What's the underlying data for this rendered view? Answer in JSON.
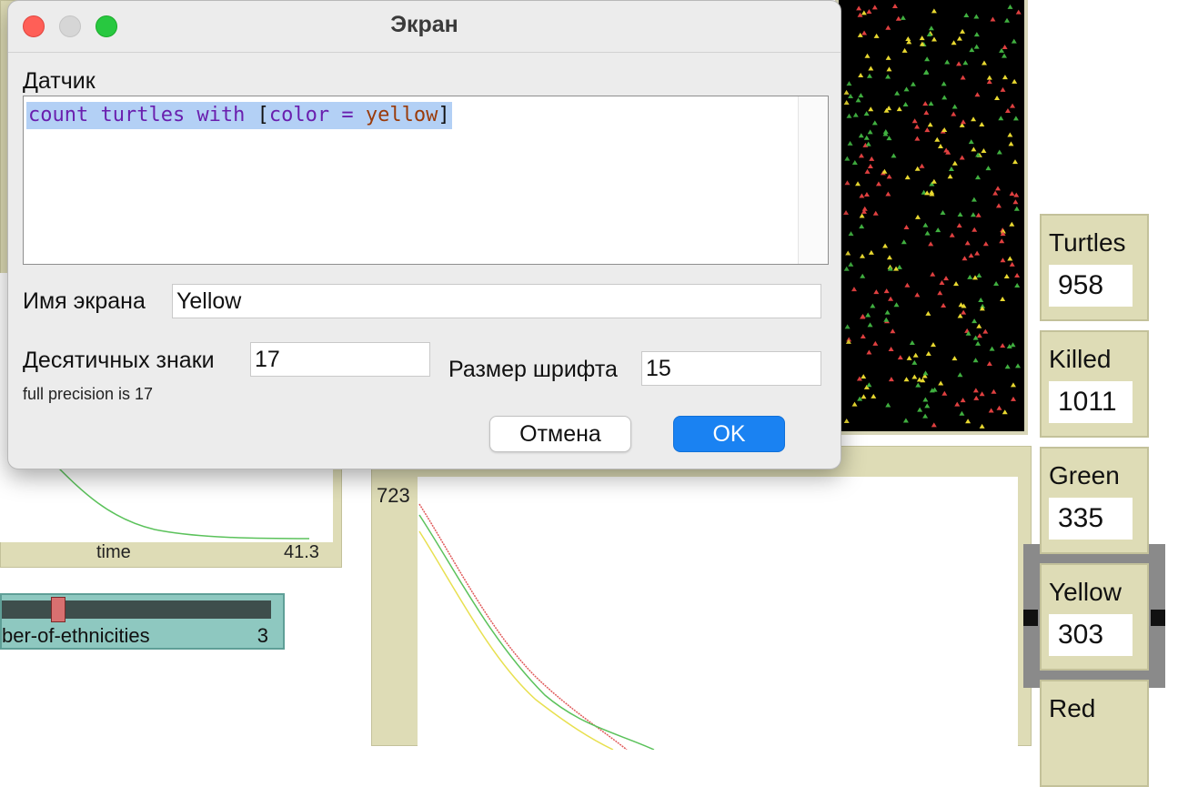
{
  "dialog": {
    "title": "Экран",
    "reporter_label": "Датчик",
    "code": {
      "part1": "count turtles with ",
      "bracket_open": "[",
      "part2": "color = ",
      "part3": "yellow",
      "bracket_close": "]"
    },
    "display_name_label": "Имя экрана",
    "display_name_value": "Yellow",
    "decimal_label": "Десятичных знаки",
    "decimal_value": "17",
    "precision_note": "full precision is 17",
    "font_size_label": "Размер шрифта",
    "font_size_value": "15",
    "cancel_label": "Отмена",
    "ok_label": "OK"
  },
  "monitors": [
    {
      "label": "Turtles",
      "value": "958"
    },
    {
      "label": "Killed",
      "value": "1011"
    },
    {
      "label": "Green",
      "value": "335"
    },
    {
      "label": "Yellow",
      "value": "303"
    },
    {
      "label": "Red",
      "value": ""
    }
  ],
  "plot": {
    "y_max_label": "723"
  },
  "left_plot": {
    "x_label": "time",
    "x_max_label": "41.3"
  },
  "slider": {
    "name": "ber-of-ethnicities",
    "value": "3"
  },
  "colors": {
    "world_bg": "#000000",
    "ok_button": "#1a82f2",
    "selection": "#b3d0f5",
    "monitor_bg": "#dedcb6",
    "slider_bg": "#8ec8c0"
  }
}
